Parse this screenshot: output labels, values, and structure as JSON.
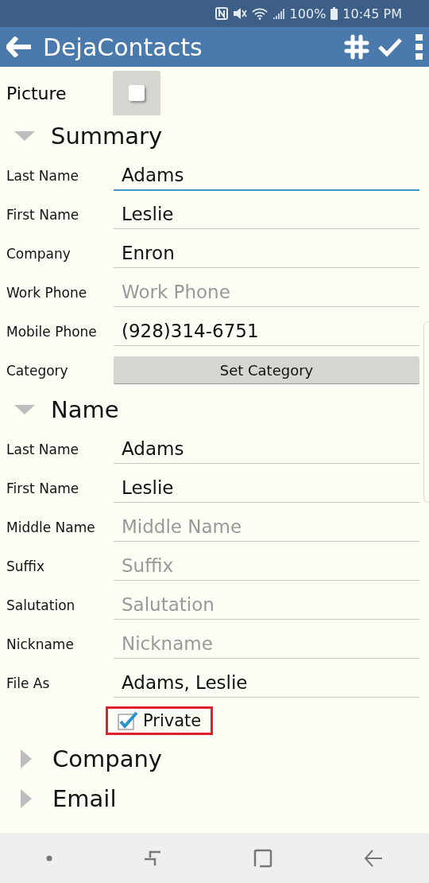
{
  "status_bar": {
    "battery": "100%",
    "time": "10:45 PM"
  },
  "app_bar": {
    "title": "DejaContacts"
  },
  "picture": {
    "label": "Picture",
    "checked": false
  },
  "sections": [
    {
      "title": "Summary",
      "expanded": true,
      "rows": [
        {
          "kind": "field",
          "label": "Last Name",
          "value": "Adams",
          "focused": true
        },
        {
          "kind": "field",
          "label": "First Name",
          "value": "Leslie",
          "focused": false
        },
        {
          "kind": "field",
          "label": "Company",
          "value": "Enron",
          "focused": false
        },
        {
          "kind": "field",
          "label": "Work Phone",
          "placeholder": "Work Phone",
          "focused": false
        },
        {
          "kind": "field",
          "label": "Mobile Phone",
          "value": "(928)314-6751",
          "focused": false
        },
        {
          "kind": "button",
          "label": "Category",
          "button": "Set Category"
        }
      ]
    },
    {
      "title": "Name",
      "expanded": true,
      "rows": [
        {
          "kind": "field",
          "label": "Last Name",
          "value": "Adams",
          "focused": false
        },
        {
          "kind": "field",
          "label": "First Name",
          "value": "Leslie",
          "focused": false
        },
        {
          "kind": "field",
          "label": "Middle Name",
          "placeholder": "Middle Name",
          "focused": false
        },
        {
          "kind": "field",
          "label": "Suffix",
          "placeholder": "Suffix",
          "focused": false
        },
        {
          "kind": "field",
          "label": "Salutation",
          "placeholder": "Salutation",
          "focused": false
        },
        {
          "kind": "field",
          "label": "Nickname",
          "placeholder": "Nickname",
          "focused": false
        },
        {
          "kind": "field",
          "label": "File As",
          "value": "Adams, Leslie",
          "focused": false
        },
        {
          "kind": "checkbox",
          "label": "Private",
          "checked": true,
          "highlighted": true
        }
      ]
    },
    {
      "title": "Company",
      "expanded": false
    },
    {
      "title": "Email",
      "expanded": false
    }
  ]
}
